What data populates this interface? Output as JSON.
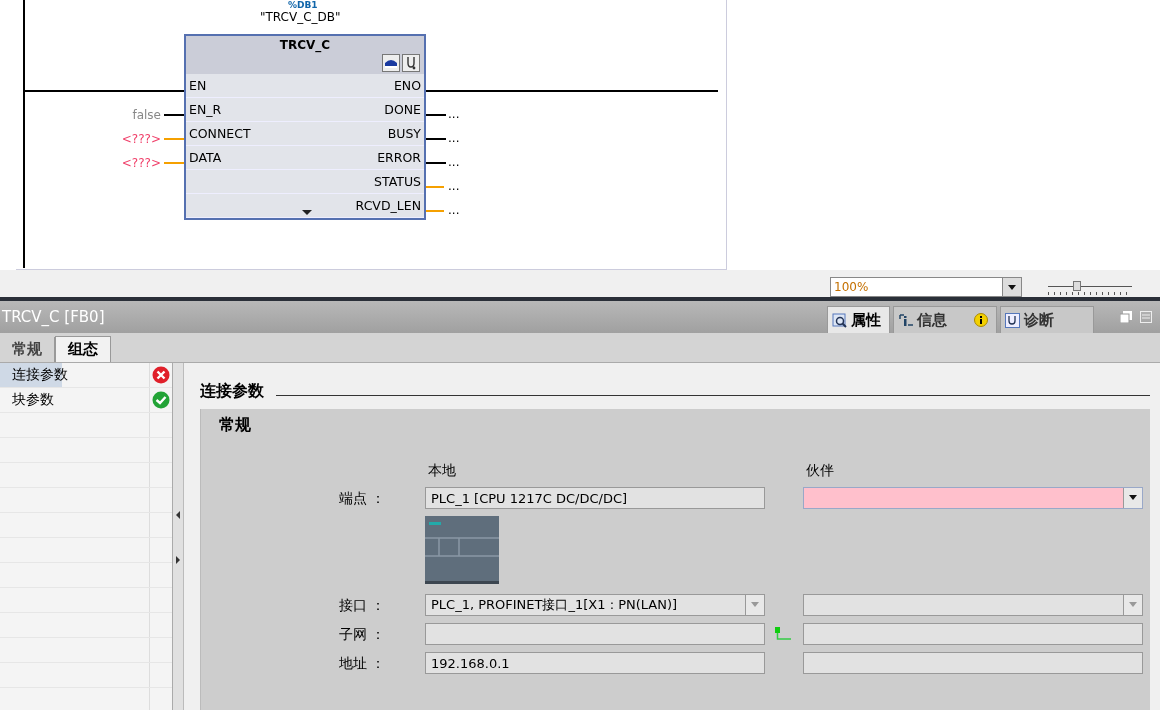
{
  "editor": {
    "instance_db": "%DB1",
    "instance_name": "\"TRCV_C_DB\"",
    "block": {
      "title": "TRCV_C",
      "inputs": [
        {
          "name": "EN",
          "kind": "rail"
        },
        {
          "name": "EN_R",
          "kind": "bool",
          "value": "false"
        },
        {
          "name": "CONNECT",
          "kind": "variant",
          "value": "<???>",
          "invalid": true
        },
        {
          "name": "DATA",
          "kind": "variant",
          "value": "<???>",
          "invalid": true
        }
      ],
      "outputs": [
        {
          "name": "ENO",
          "kind": "rail"
        },
        {
          "name": "DONE",
          "kind": "bool",
          "value": "..."
        },
        {
          "name": "BUSY",
          "kind": "bool",
          "value": "..."
        },
        {
          "name": "ERROR",
          "kind": "bool",
          "value": "..."
        },
        {
          "name": "STATUS",
          "kind": "word",
          "value": "..."
        },
        {
          "name": "RCVD_LEN",
          "kind": "word",
          "value": "..."
        }
      ]
    },
    "zoom": {
      "value": "100%",
      "level": 0.35
    }
  },
  "inspector": {
    "title": "TRCV_C [FB0]",
    "view_tabs": [
      {
        "label": "属性",
        "selected": true,
        "kind": "properties"
      },
      {
        "label": "信息",
        "selected": false,
        "kind": "info",
        "badge": true
      },
      {
        "label": "诊断",
        "selected": false,
        "kind": "diagnostics"
      }
    ],
    "tabs": [
      {
        "label": "常规",
        "selected": false
      },
      {
        "label": "组态",
        "selected": true
      }
    ],
    "nav": [
      {
        "label": "连接参数",
        "selected": true,
        "error": true
      },
      {
        "label": "块参数",
        "selected": false,
        "error": false
      }
    ],
    "section": {
      "title": "连接参数",
      "group": "常规",
      "columns": [
        "本地",
        "伙伴"
      ],
      "rows": [
        {
          "kind": "field",
          "label": "端点 ：",
          "local": {
            "kind": "text",
            "value": "PLC_1 [CPU 1217C DC/DC/DC]"
          },
          "partner": {
            "kind": "dropdown",
            "invalid": true
          }
        },
        {
          "kind": "picture"
        },
        {
          "kind": "field",
          "label": "接口 ：",
          "local": {
            "kind": "dropdown",
            "value": "PLC_1, PROFINET接口_1[X1 : PN(LAN)]"
          },
          "partner": {
            "kind": "dropdown"
          }
        },
        {
          "kind": "field",
          "label": "子网 ：",
          "local": {
            "kind": "text"
          },
          "partner": {
            "kind": "text",
            "network": true
          }
        },
        {
          "kind": "field",
          "label": "地址 ：",
          "local": {
            "kind": "text",
            "value": "192.168.0.1"
          },
          "partner": {
            "kind": "text"
          }
        }
      ]
    }
  }
}
